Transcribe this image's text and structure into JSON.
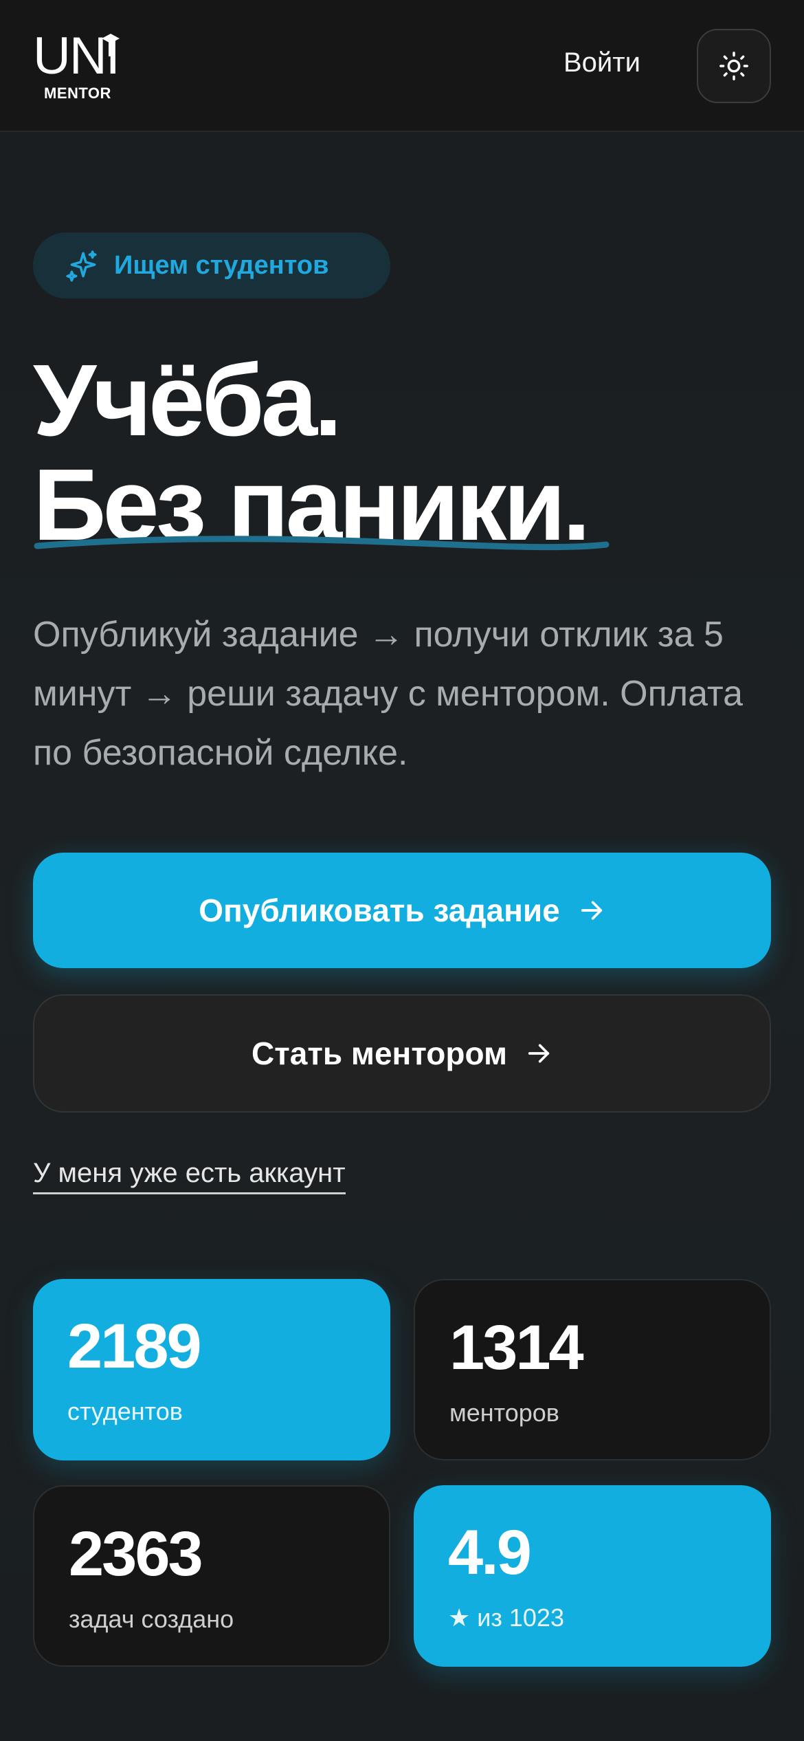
{
  "header": {
    "logo_main": "UNI",
    "logo_sub": "MENTOR",
    "login_label": "Войти",
    "theme_icon": "sun-icon"
  },
  "hero": {
    "badge_icon": "sparkles-icon",
    "badge_text": "Ищем студентов",
    "title_line1": "Учёба.",
    "title_line2": "Без паники.",
    "subtitle": "Опубликуй задание → получи отклик за 5 минут → реши задачу с ментором. Оплата по безопасной сделке."
  },
  "actions": {
    "primary_label": "Опубликовать задание",
    "secondary_label": "Стать ментором",
    "arrow_icon": "arrow-right-icon",
    "account_link": "У меня уже есть аккаунт"
  },
  "stats": [
    {
      "value": "2189",
      "label": "студентов"
    },
    {
      "value": "1314",
      "label": "менторов"
    },
    {
      "value": "2363",
      "label": "задач создано"
    },
    {
      "value": "4.9",
      "label": "★ из 1023"
    }
  ],
  "colors": {
    "accent": "#12aee0",
    "background": "#1b1e20",
    "header": "#161616",
    "badge_bg": "#17303a",
    "badge_text": "#21a9df",
    "underline": "#1f6f8e"
  }
}
